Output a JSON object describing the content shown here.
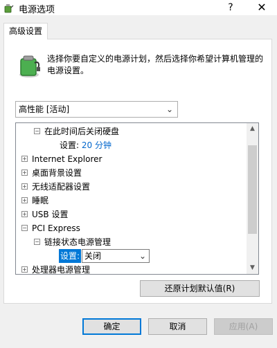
{
  "window": {
    "title": "电源选项",
    "help_glyph": "?",
    "close_glyph": "✕"
  },
  "tab": {
    "label": "高级设置"
  },
  "description": "选择你要自定义的电源计划，然后选择你希望计算机管理的电源设置。",
  "plan_select": {
    "value": "高性能 [活动]"
  },
  "tree": {
    "rows": [
      {
        "label": "在此时间后关闭硬盘",
        "expander": "⊟"
      },
      {
        "label": "设置:",
        "value": "20 分钟"
      },
      {
        "label": "Internet Explorer",
        "expander": "⊞"
      },
      {
        "label": "桌面背景设置",
        "expander": "⊞"
      },
      {
        "label": "无线适配器设置",
        "expander": "⊞"
      },
      {
        "label": "睡眠",
        "expander": "⊞"
      },
      {
        "label": "USB 设置",
        "expander": "⊞"
      },
      {
        "label": "PCI Express",
        "expander": "⊟"
      },
      {
        "label": "链接状态电源管理",
        "expander": "⊟"
      },
      {
        "label": "设置:",
        "value": "关闭"
      },
      {
        "label": "处理器电源管理",
        "expander": "⊞"
      }
    ]
  },
  "buttons": {
    "restore_defaults": "还原计划默认值(R)",
    "ok": "确定",
    "cancel": "取消",
    "apply": "应用(A)"
  },
  "icons": {
    "app": "power-options-icon",
    "battery": "battery-plug-icon",
    "expand": "plus-box-icon",
    "collapse": "minus-box-icon",
    "dropdown": "chevron-down-icon"
  },
  "colors": {
    "accent": "#0078d7",
    "link_value": "#0066cc",
    "battery_green": "#4caf50"
  }
}
